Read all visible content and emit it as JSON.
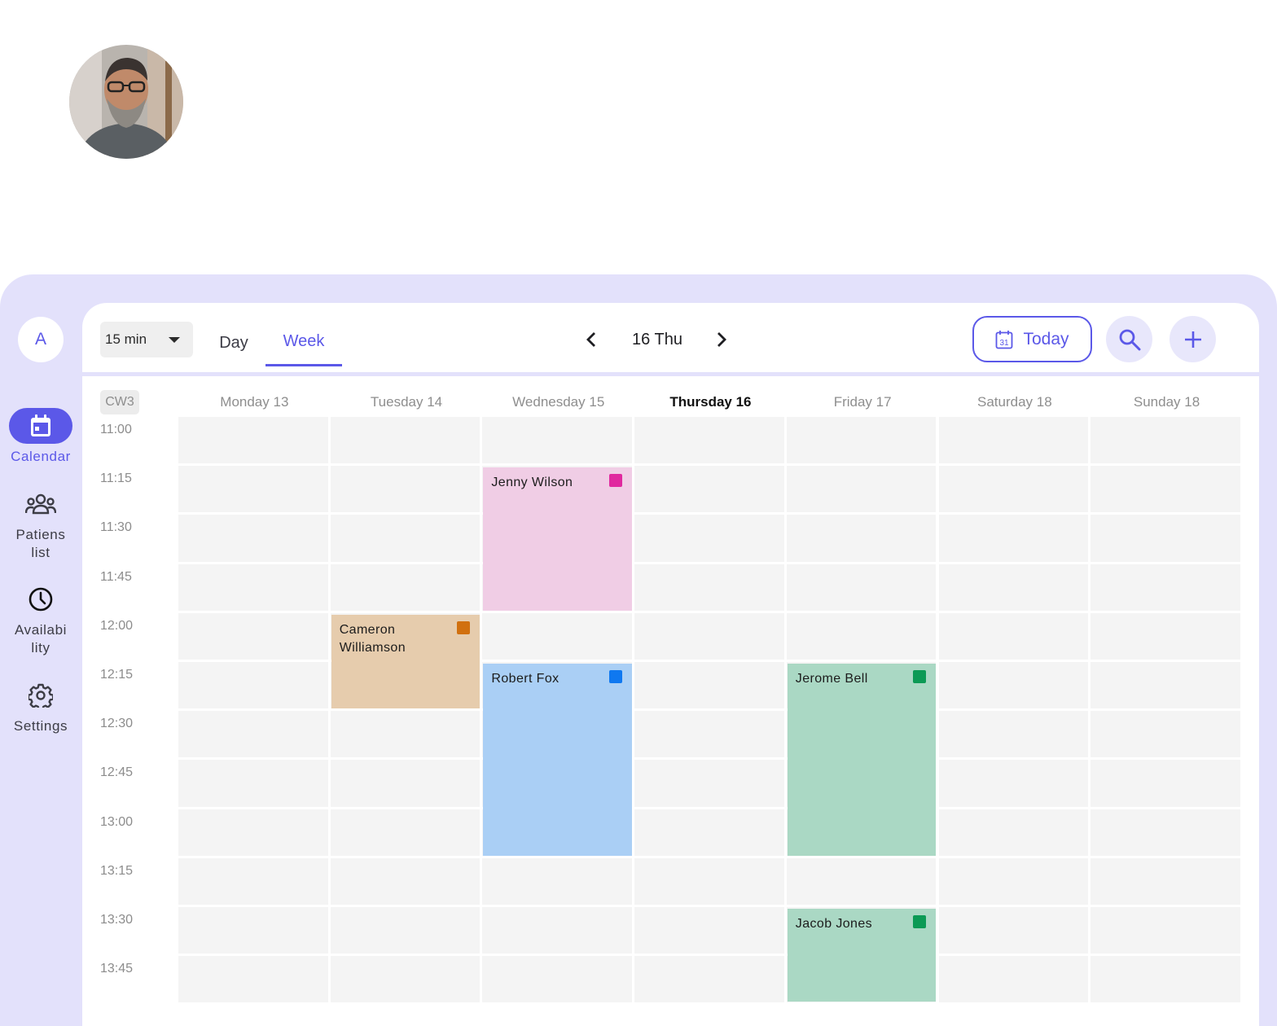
{
  "sidebar": {
    "user_initial": "A",
    "items": [
      {
        "label": "Calendar",
        "icon": "calendar-icon",
        "active": true
      },
      {
        "label": "Patiens\nlist",
        "icon": "users-icon",
        "active": false
      },
      {
        "label": "Availabi\nlity",
        "icon": "clock-icon",
        "active": false
      },
      {
        "label": "Settings",
        "icon": "gear-icon",
        "active": false
      }
    ]
  },
  "toolbar": {
    "interval": "15 min",
    "tab_day": "Day",
    "tab_week": "Week",
    "current_date": "16 Thu",
    "today_label": "Today",
    "calendar_icon_day": "31"
  },
  "calendar": {
    "week_label": "CW3",
    "days": [
      "Monday 13",
      "Tuesday 14",
      "Wednesday 15",
      "Thursday 16",
      "Friday 17",
      "Saturday 18",
      "Sunday 18"
    ],
    "today_index": 3,
    "times": [
      "11:00",
      "11:15",
      "11:30",
      "11:45",
      "12:00",
      "12:15",
      "12:30",
      "12:45",
      "13:00",
      "13:15",
      "13:30",
      "13:45"
    ],
    "events": [
      {
        "name": "Jenny Wilson",
        "day": 2,
        "start": "11:15",
        "end": "12:00",
        "bg": "#f0cde5",
        "marker": "#e0289f"
      },
      {
        "name": "Cameron Williamson",
        "day": 1,
        "start": "12:00",
        "end": "12:30",
        "bg": "#e6ccad",
        "marker": "#d1700f"
      },
      {
        "name": "Robert Fox",
        "day": 2,
        "start": "12:15",
        "end": "13:15",
        "bg": "#aacff5",
        "marker": "#0f78f0"
      },
      {
        "name": "Jerome Bell",
        "day": 4,
        "start": "12:15",
        "end": "13:15",
        "bg": "#aad8c4",
        "marker": "#0c9a55"
      },
      {
        "name": "Jacob Jones",
        "day": 4,
        "start": "13:30",
        "end": "14:00",
        "bg": "#aad8c4",
        "marker": "#0c9a55"
      }
    ]
  },
  "colors": {
    "accent": "#5b58e8",
    "shell_bg": "#e3e1fb"
  }
}
